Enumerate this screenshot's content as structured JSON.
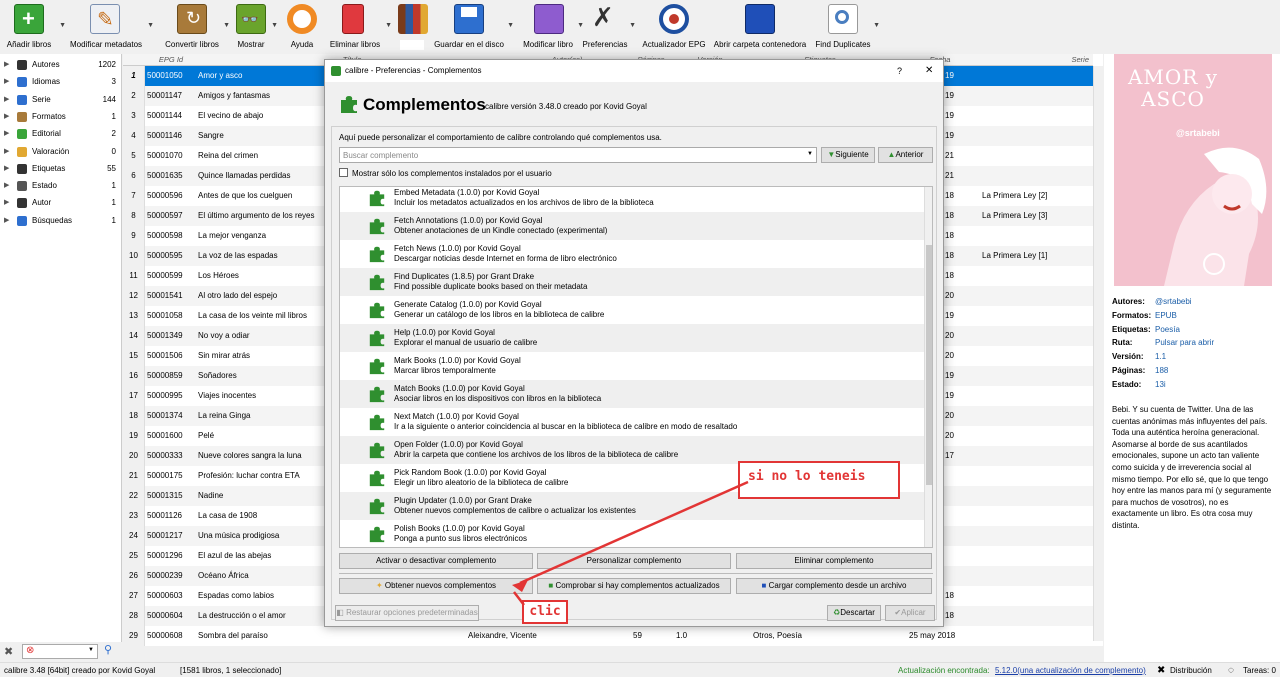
{
  "toolbar": {
    "add_books": "Añadir libros",
    "edit_metadata": "Modificar metadatos",
    "convert": "Convertir libros",
    "view": "Mostrar",
    "help": "Ayuda",
    "remove": "Eliminar libros",
    "save": "Guardar en el disco",
    "edit_book": "Modificar libro",
    "preferences": "Preferencias",
    "epg": "Actualizador EPG",
    "open_folder": "Abrir carpeta contenedora",
    "find_dupes": "Find Duplicates"
  },
  "sidebar": {
    "items": [
      {
        "label": "Autores",
        "count": "1202"
      },
      {
        "label": "Idiomas",
        "count": "3"
      },
      {
        "label": "Serie",
        "count": "144"
      },
      {
        "label": "Formatos",
        "count": "1"
      },
      {
        "label": "Editorial",
        "count": "2"
      },
      {
        "label": "Valoración",
        "count": "0"
      },
      {
        "label": "Etiquetas",
        "count": "55"
      },
      {
        "label": "Estado",
        "count": "1"
      },
      {
        "label": "Autor",
        "count": "1"
      },
      {
        "label": "Búsquedas",
        "count": "1"
      }
    ]
  },
  "table": {
    "headers": {
      "epg": "EPG Id",
      "title": "Título",
      "authors": "Autor(es)",
      "pages": "Páginas",
      "version": "Versión",
      "tags": "Etiquetas",
      "date": "Fecha",
      "series": "Serie"
    },
    "rows": [
      {
        "n": "1",
        "id": "50001050",
        "title": "Amor y asco",
        "extra": "19",
        "series": ""
      },
      {
        "n": "2",
        "id": "50001147",
        "title": "Amigos y fantasmas",
        "extra": "19",
        "series": ""
      },
      {
        "n": "3",
        "id": "50001144",
        "title": "El vecino de abajo",
        "extra": "19",
        "series": ""
      },
      {
        "n": "4",
        "id": "50001146",
        "title": "Sangre",
        "extra": "19",
        "series": ""
      },
      {
        "n": "5",
        "id": "50001070",
        "title": "Reina del crimen",
        "extra": "21",
        "series": ""
      },
      {
        "n": "6",
        "id": "50001635",
        "title": "Quince llamadas perdidas",
        "extra": "21",
        "series": ""
      },
      {
        "n": "7",
        "id": "50000596",
        "title": "Antes de que los cuelguen",
        "extra": "18",
        "series": "La Primera Ley [2]"
      },
      {
        "n": "8",
        "id": "50000597",
        "title": "El último argumento de los reyes",
        "extra": "18",
        "series": "La Primera Ley [3]"
      },
      {
        "n": "9",
        "id": "50000598",
        "title": "La mejor venganza",
        "extra": "18",
        "series": ""
      },
      {
        "n": "10",
        "id": "50000595",
        "title": "La voz de las espadas",
        "extra": "18",
        "series": "La Primera Ley [1]"
      },
      {
        "n": "11",
        "id": "50000599",
        "title": "Los Héroes",
        "extra": "18",
        "series": ""
      },
      {
        "n": "12",
        "id": "50001541",
        "title": "Al otro lado del espejo",
        "extra": "20",
        "series": ""
      },
      {
        "n": "13",
        "id": "50001058",
        "title": "La casa de los veinte mil libros",
        "extra": "19",
        "series": ""
      },
      {
        "n": "14",
        "id": "50001349",
        "title": "No voy a odiar",
        "extra": "20",
        "series": ""
      },
      {
        "n": "15",
        "id": "50001506",
        "title": "Sin mirar atrás",
        "extra": "20",
        "series": ""
      },
      {
        "n": "16",
        "id": "50000859",
        "title": "Soñadores",
        "extra": "19",
        "series": ""
      },
      {
        "n": "17",
        "id": "50000995",
        "title": "Viajes inocentes",
        "extra": "19",
        "series": ""
      },
      {
        "n": "18",
        "id": "50001374",
        "title": "La reina Ginga",
        "extra": "20",
        "series": ""
      },
      {
        "n": "19",
        "id": "50001600",
        "title": "Pelé",
        "extra": "20",
        "series": ""
      },
      {
        "n": "20",
        "id": "50000333",
        "title": "Nueve colores sangra la luna",
        "extra": "17",
        "series": ""
      },
      {
        "n": "21",
        "id": "50000175",
        "title": "Profesión: luchar contra ETA",
        "extra": "",
        "series": ""
      },
      {
        "n": "22",
        "id": "50001315",
        "title": "Nadine",
        "extra": "",
        "series": ""
      },
      {
        "n": "23",
        "id": "50001126",
        "title": "La casa de 1908",
        "extra": "",
        "series": ""
      },
      {
        "n": "24",
        "id": "50001217",
        "title": "Una música prodigiosa",
        "extra": "",
        "series": ""
      },
      {
        "n": "25",
        "id": "50001296",
        "title": "El azul de las abejas",
        "extra": "",
        "series": ""
      },
      {
        "n": "26",
        "id": "50000239",
        "title": "Océano África",
        "extra": "",
        "series": ""
      },
      {
        "n": "27",
        "id": "50000603",
        "title": "Espadas como labios",
        "extra": "18",
        "series": ""
      },
      {
        "n": "28",
        "id": "50000604",
        "title": "La destrucción o el amor",
        "extra": "18",
        "series": ""
      },
      {
        "n": "29",
        "id": "50000608",
        "title": "Sombra del paraíso",
        "extra": "25 may 2018",
        "series": "",
        "author": "Aleixandre, Vicente",
        "pages": "59",
        "version": "1.0",
        "tags": "Otros, Poesía"
      }
    ]
  },
  "book": {
    "cover_title": "AMOR y ASCO",
    "cover_author": "@srtabebi",
    "fields": [
      {
        "k": "Autores:",
        "v": "@srtabebi"
      },
      {
        "k": "Formatos:",
        "v": "EPUB"
      },
      {
        "k": "Etiquetas:",
        "v": "Poesía"
      },
      {
        "k": "Ruta:",
        "v": "Pulsar para abrir"
      },
      {
        "k": "Versión:",
        "v": "1.1"
      },
      {
        "k": "Páginas:",
        "v": "188"
      },
      {
        "k": "Estado:",
        "v": "13i"
      }
    ],
    "description": "Bebi. Y su cuenta de Twitter. Una de las cuentas anónimas más influyentes del país. Toda una auténtica heroína generacional. Asomarse al borde de sus acantilados emocionales, supone un acto tan valiente como suicida y de irreverencia social al mismo tiempo. Por ello sé, que lo que tengo hoy entre las manos para mí (y seguramente para muchos de vosotros), no es exactamente un libro. Es otra cosa muy distinta."
  },
  "status": {
    "left": "calibre 3.48 [64bit] creado por Kovid Goyal",
    "count": "[1581 libros, 1 seleccionado]",
    "update_label": "Actualización encontrada:",
    "update_link": "5.12.0(una actualización de complemento)",
    "distribution": "Distribución",
    "tasks": "Tareas: 0"
  },
  "dialog": {
    "window_title": "calibre - Preferencias - Complementos",
    "help_glyph": "?",
    "close_glyph": "✕",
    "heading": "Complementos",
    "version": "calibre versión 3.48.0 creado por Kovid Goyal",
    "intro": "Aquí puede personalizar el comportamiento de calibre controlando qué complementos usa.",
    "search_placeholder": "Buscar complemento",
    "next": "Siguiente",
    "prev": "Anterior",
    "only_user": "Mostrar sólo los complementos instalados por el usuario",
    "plugins": [
      {
        "t": "Embed Metadata (1.0.0) por Kovid Goyal",
        "d": "Incluir los metadatos actualizados en los archivos de libro de la biblioteca"
      },
      {
        "t": "Fetch Annotations (1.0.0) por Kovid Goyal",
        "d": "Obtener anotaciones de un Kindle conectado (experimental)"
      },
      {
        "t": "Fetch News (1.0.0) por Kovid Goyal",
        "d": "Descargar noticias desde Internet en forma de libro electrónico"
      },
      {
        "t": "Find Duplicates (1.8.5) por Grant Drake",
        "d": "Find possible duplicate books based on their metadata"
      },
      {
        "t": "Generate Catalog (1.0.0) por Kovid Goyal",
        "d": "Generar un catálogo de los libros en la biblioteca de calibre"
      },
      {
        "t": "Help (1.0.0) por Kovid Goyal",
        "d": "Explorar el manual de usuario de calibre"
      },
      {
        "t": "Mark Books (1.0.0) por Kovid Goyal",
        "d": "Marcar libros temporalmente"
      },
      {
        "t": "Match Books (1.0.0) por Kovid Goyal",
        "d": "Asociar libros en los dispositivos con libros en la biblioteca"
      },
      {
        "t": "Next Match (1.0.0) por Kovid Goyal",
        "d": "Ir a la siguiente o anterior coincidencia al buscar en la biblioteca de calibre en modo de resaltado"
      },
      {
        "t": "Open Folder (1.0.0) por Kovid Goyal",
        "d": "Abrir la carpeta que contiene los archivos de los libros de la biblioteca de calibre"
      },
      {
        "t": "Pick Random Book (1.0.0) por Kovid Goyal",
        "d": "Elegir un libro aleatorio de la biblioteca de calibre"
      },
      {
        "t": "Plugin Updater (1.0.0) por Grant Drake",
        "d": "Obtener nuevos complementos de calibre o actualizar los existentes"
      },
      {
        "t": "Polish Books (1.0.0) por Kovid Goyal",
        "d": "Ponga a punto sus libros electrónicos"
      }
    ],
    "toggle": "Activar o desactivar complemento",
    "customize": "Personalizar complemento",
    "remove": "Eliminar complemento",
    "get_new": "Obtener nuevos complementos",
    "check_updates": "Comprobar si hay complementos actualizados",
    "load_file": "Cargar complemento desde un archivo",
    "restore": "Restaurar opciones predeterminadas",
    "discard": "Descartar",
    "apply": "Aplicar"
  },
  "annotations": {
    "note1": "si no lo teneis",
    "note2": "clic"
  },
  "colors": {
    "accent": "#0078d7",
    "annotation": "#e23535",
    "plugin_green": "#2f8f2f"
  }
}
